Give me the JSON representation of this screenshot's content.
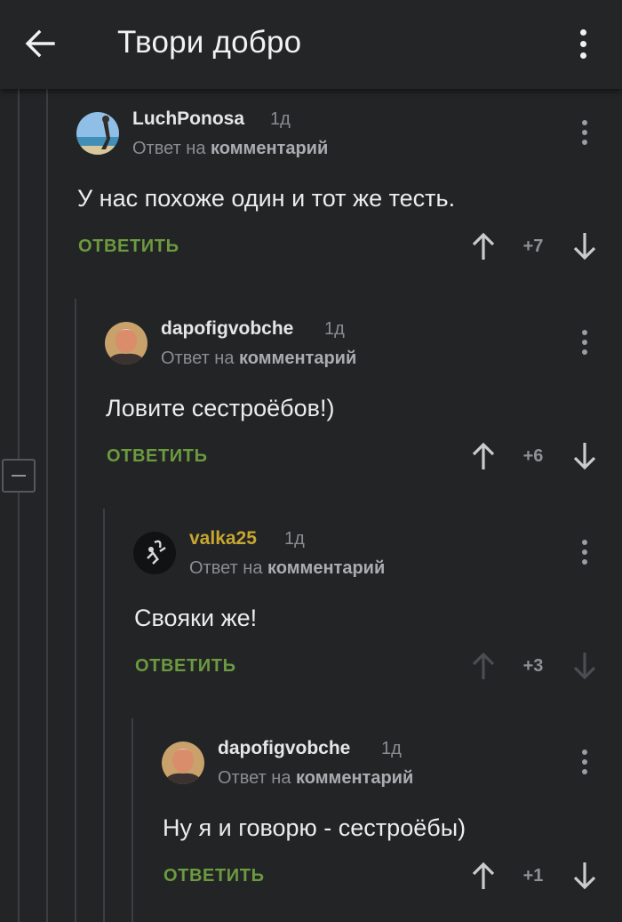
{
  "header": {
    "title": "Твори добро"
  },
  "colors": {
    "background": "#222426",
    "reply_green": "#6c9a3f",
    "username_gold": "#c7a631",
    "muted": "#8a8d91"
  },
  "comments": [
    {
      "username": "LuchPonosa",
      "time": "1д",
      "reply_prefix": "Ответ на",
      "reply_target": "комментарий",
      "text": "У нас похоже один и тот же тесть.",
      "reply_label": "ОТВЕТИТЬ",
      "score": "+7",
      "avatar_icon": "avatar-beach-icon"
    },
    {
      "username": "dapofigvobche",
      "time": "1д",
      "reply_prefix": "Ответ на",
      "reply_target": "комментарий",
      "text": "Ловите сестроёбов!)",
      "reply_label": "ОТВЕТИТЬ",
      "score": "+6",
      "avatar_icon": "avatar-man-icon"
    },
    {
      "username": "valka25",
      "time": "1д",
      "reply_prefix": "Ответ на",
      "reply_target": "комментарий",
      "text": "Свояки же!",
      "reply_label": "ОТВЕТИТЬ",
      "score": "+3",
      "avatar_icon": "avatar-scorpion-icon"
    },
    {
      "username": "dapofigvobche",
      "time": "1д",
      "reply_prefix": "Ответ на",
      "reply_target": "комментарий",
      "text": "Ну я и говорю - сестроёбы)",
      "reply_label": "ОТВЕТИТЬ",
      "score": "+1",
      "avatar_icon": "avatar-man-icon"
    }
  ]
}
